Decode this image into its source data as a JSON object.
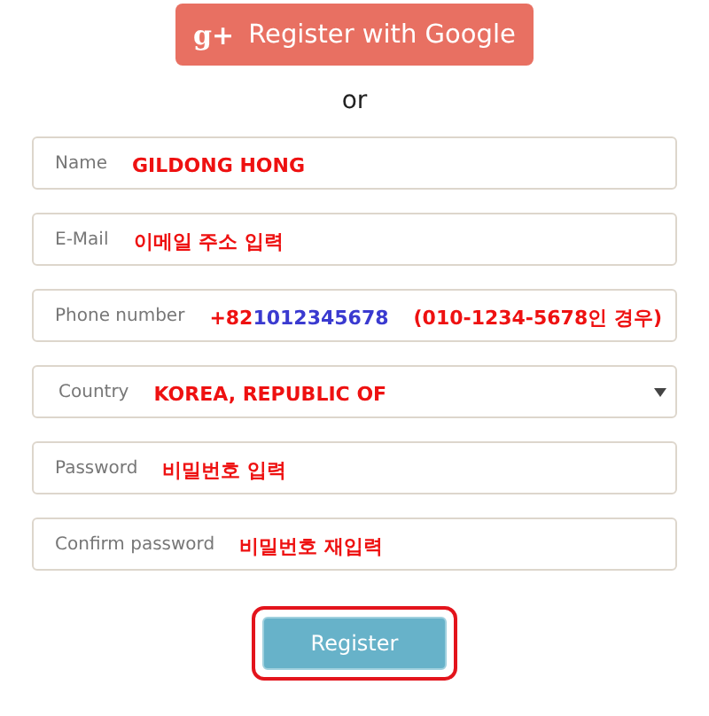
{
  "google_button": {
    "icon": "g+",
    "label": "Register with Google"
  },
  "separator": "or",
  "fields": [
    {
      "kind": "input",
      "placeholder": "Name",
      "annotations": [
        {
          "parts": [
            {
              "text": "GILDONG HONG",
              "color": "#ee1111"
            }
          ]
        }
      ]
    },
    {
      "kind": "input",
      "placeholder": "E-Mail",
      "annotations": [
        {
          "parts": [
            {
              "text": "이메일 주소 입력",
              "color": "#ee1111"
            }
          ]
        }
      ]
    },
    {
      "kind": "input",
      "placeholder": "Phone number",
      "annotations": [
        {
          "parts": [
            {
              "text": "+82",
              "color": "#ee1111"
            },
            {
              "text": "1012345678",
              "color": "#3a3ad0"
            }
          ]
        },
        {
          "parts": [
            {
              "text": "(010-1234-5678인 경우)",
              "color": "#ee1111"
            }
          ]
        }
      ]
    },
    {
      "kind": "select",
      "placeholder": "Country",
      "annotations": [
        {
          "parts": [
            {
              "text": "KOREA, REPUBLIC OF",
              "color": "#ee1111"
            }
          ]
        }
      ]
    },
    {
      "kind": "input",
      "placeholder": "Password",
      "annotations": [
        {
          "parts": [
            {
              "text": "비밀번호 입력",
              "color": "#ee1111"
            }
          ]
        }
      ]
    },
    {
      "kind": "input",
      "placeholder": "Confirm password",
      "annotations": [
        {
          "parts": [
            {
              "text": "비밀번호 재입력",
              "color": "#ee1111"
            }
          ]
        }
      ]
    }
  ],
  "register_button": {
    "label": "Register",
    "highlighted": true
  }
}
